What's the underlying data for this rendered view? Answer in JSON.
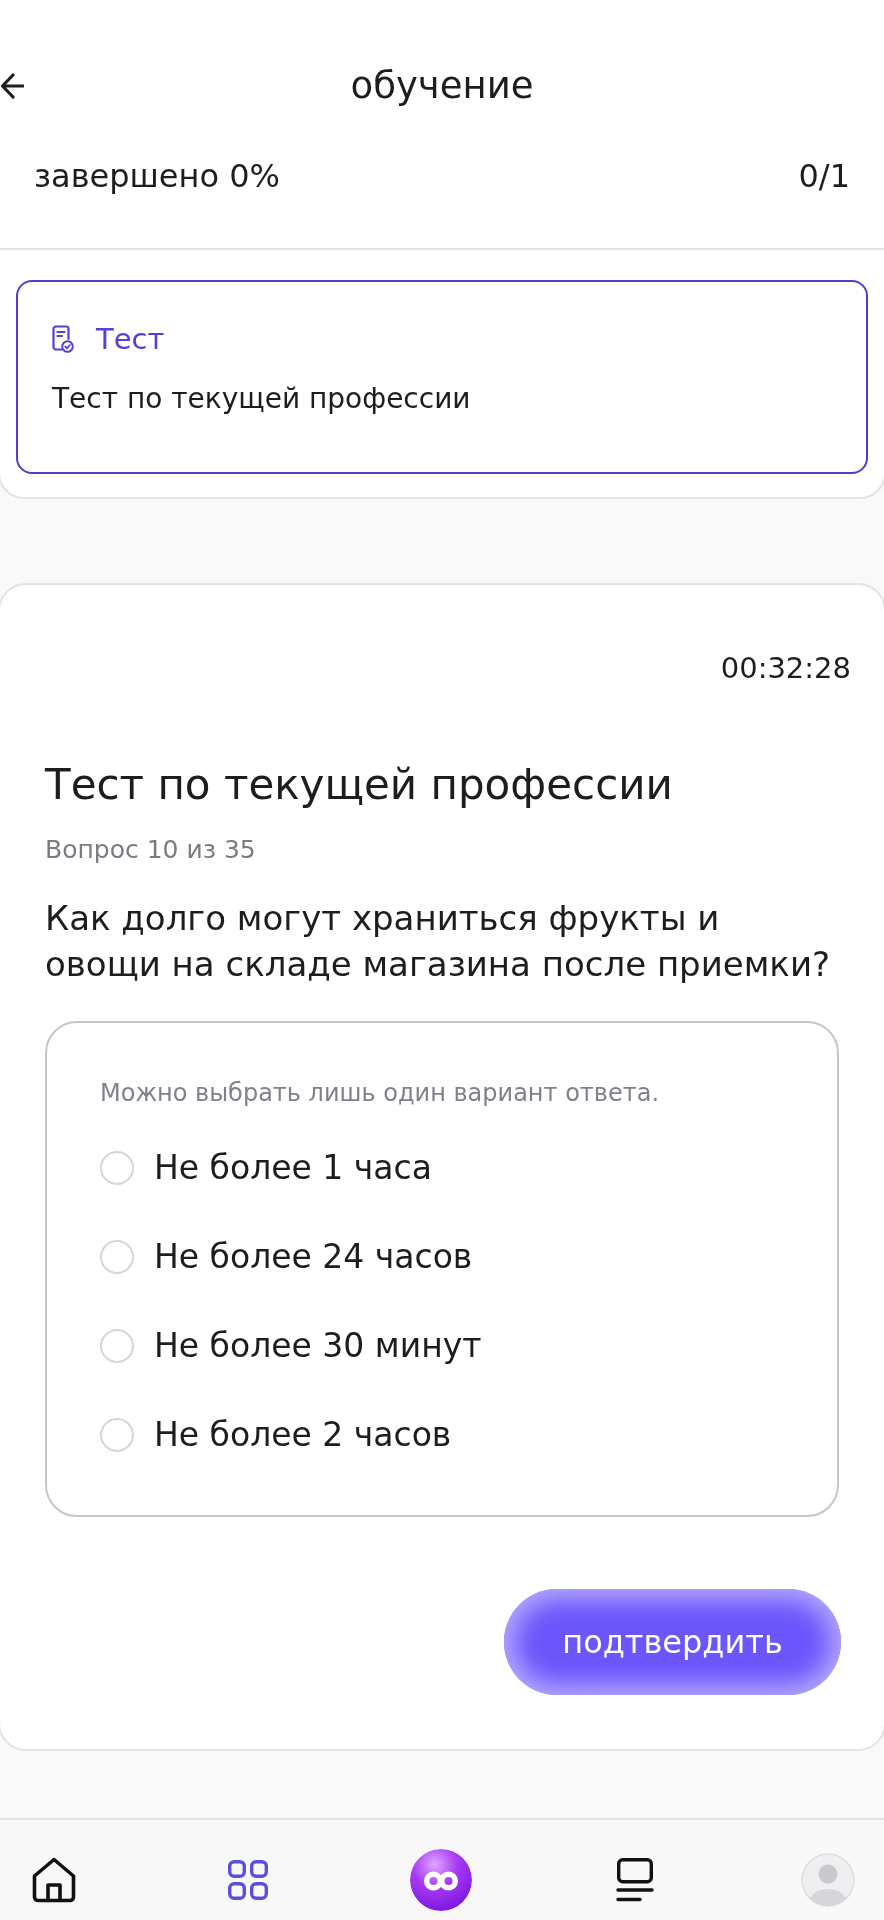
{
  "header": {
    "title": "обучение"
  },
  "progress": {
    "label": "завершено 0%",
    "count": "0/1"
  },
  "lessons": [
    {
      "kind": "test",
      "type_label": "Тест",
      "title": "Тест по текущей профессии",
      "selected": true
    }
  ],
  "quiz": {
    "timer": "00:32:28",
    "title": "Тест по текущей профессии",
    "counter": "Вопрос 10 из 35",
    "question": "Как долго могут храниться фрукты и овощи на складе магазина после приемки?",
    "hint": "Можно выбрать лишь один вариант ответа.",
    "options": [
      {
        "label": "Не более 1 часа",
        "selected": false
      },
      {
        "label": "Не более 24 часов",
        "selected": false
      },
      {
        "label": "Не более 30 минут",
        "selected": false
      },
      {
        "label": "Не более 2 часов",
        "selected": false
      }
    ],
    "submit": "подтвердить"
  },
  "bottom_nav": [
    {
      "kind": "home",
      "selected": false
    },
    {
      "kind": "grid",
      "selected": true
    },
    {
      "kind": "logo",
      "selected": false
    },
    {
      "kind": "list",
      "selected": false
    },
    {
      "kind": "avatar",
      "selected": false
    }
  ]
}
